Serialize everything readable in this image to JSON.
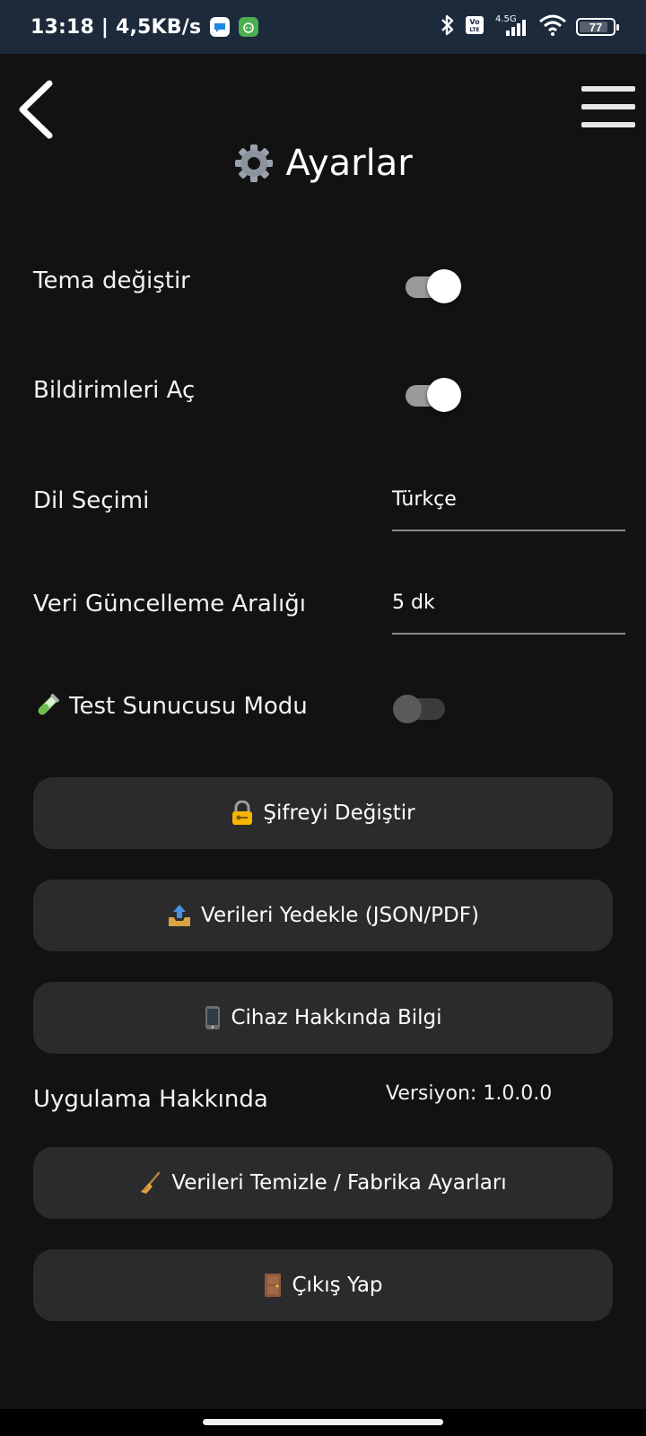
{
  "status_bar": {
    "time_speed": "13:18 | 4,5KB/s",
    "network_type": "4.5G",
    "volte_label": "Vo LTE",
    "battery_level": "77"
  },
  "header": {
    "title": "Ayarlar",
    "title_icon": "gear-icon",
    "back_icon": "chevron-left-icon",
    "menu_icon": "hamburger-menu-icon"
  },
  "settings": {
    "theme": {
      "label": "Tema değiştir",
      "enabled": true
    },
    "notifications": {
      "label": "Bildirimleri Aç",
      "enabled": true
    },
    "language": {
      "label": "Dil Seçimi",
      "value": "Türkçe"
    },
    "refresh_interval": {
      "label": "Veri Güncelleme Aralığı",
      "value": "5 dk"
    },
    "test_server": {
      "icon": "test-tube-icon",
      "label": "Test Sunucusu Modu",
      "enabled": false
    }
  },
  "buttons": {
    "change_password": {
      "icon": "lock-key-icon",
      "label": "Şifreyi Değiştir"
    },
    "backup": {
      "icon": "outbox-tray-icon",
      "label": "Verileri Yedekle (JSON/PDF)"
    },
    "device_info": {
      "icon": "mobile-phone-icon",
      "label": "Cihaz Hakkında Bilgi"
    },
    "clear_data": {
      "icon": "broom-icon",
      "label": "Verileri Temizle / Fabrika Ayarları"
    },
    "logout": {
      "icon": "door-icon",
      "label": "Çıkış Yap"
    }
  },
  "about": {
    "label": "Uygulama Hakkında",
    "version": "Versiyon: 1.0.0.0"
  },
  "colors": {
    "background": "#121212",
    "status_bar": "#1c2a3c",
    "button_bg": "#2b2b2d",
    "toggle_on_track": "#9a9a9a",
    "toggle_off_track": "#3c3c3c"
  }
}
